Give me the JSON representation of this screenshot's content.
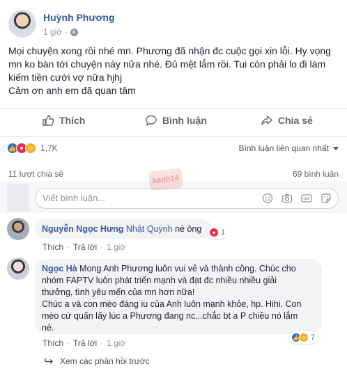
{
  "post": {
    "author": "Huỳnh Phương",
    "time": "1 giờ",
    "lines": [
      "Mọi chuyện xong rồi nhé mn. Phương đã nhận đc cuộc gọi xin lỗi. Hy vọng",
      "mn ko bàn tới chuyện này nữa nhé. Đủ mệt lắm rồi. Tui còn phải lo đi làm",
      "kiếm tiền cưới vợ nữa hjhj",
      "Cảm ơn anh em đã quan tâm"
    ]
  },
  "actions": {
    "like": "Thích",
    "comment": "Bình luận",
    "share": "Chia sẻ"
  },
  "stats": {
    "reaction_count": "1,7K",
    "relevant_label": "Bình luận liên quan nhất",
    "shares": "11 lượt chia sẻ",
    "comments": "69 bình luận"
  },
  "composer": {
    "placeholder": "Viết bình luận..."
  },
  "watermark": "kenh14",
  "comments": [
    {
      "name": "Nguyễn Ngọc Hưng",
      "tag": "Nhật Quỳnh",
      "text": " nè ông",
      "reactions": "1",
      "like": "Thích",
      "reply": "Trả lời",
      "time": "1 giờ"
    },
    {
      "name": "Ngọc Hà",
      "lines": [
        " Mong Anh Phương luôn vui vẻ và thành công. Chúc cho",
        "nhóm FAPTV luôn phát triển mạnh và đạt đc nhiều nhiều giải",
        "thưởng, tình yêu mến của mn hơn nữa!",
        "Chúc a và con mèo đáng iu của Anh luôn mạnh khỏe, hp. Hihi. Con",
        "mèo cứ quấn lấy lúc a Phương đang nc...chắc bt a P chiều nó lắm",
        "nè."
      ],
      "reactions": "7",
      "like": "Thích",
      "reply": "Trả lời",
      "time": "1 giờ"
    }
  ],
  "more_replies": "Xem các phản hồi trước",
  "colors": {
    "link": "#385898",
    "like": "#2f6de1",
    "love": "#f0284a",
    "haha": "#f7b125"
  }
}
